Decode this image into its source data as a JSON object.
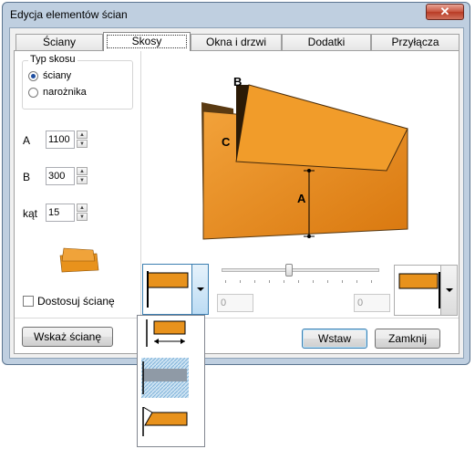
{
  "window": {
    "title": "Edycja elementów ścian",
    "close_glyph": "✕"
  },
  "tabs": [
    {
      "label": "Ściany",
      "active": false
    },
    {
      "label": "Skosy",
      "active": true
    },
    {
      "label": "Okna i drzwi",
      "active": false
    },
    {
      "label": "Dodatki",
      "active": false
    },
    {
      "label": "Przyłącza",
      "active": false
    }
  ],
  "slope_type": {
    "label": "Typ skosu",
    "options": [
      {
        "label": "ściany",
        "selected": true
      },
      {
        "label": "narożnika",
        "selected": false
      }
    ]
  },
  "fields": {
    "a": {
      "label": "A",
      "value": "1100"
    },
    "b": {
      "label": "B",
      "value": "300"
    },
    "angle": {
      "label": "kąt",
      "value": "15"
    }
  },
  "fit_wall": {
    "label": "Dostosuj ścianę",
    "checked": false
  },
  "preview": {
    "label_a": "A",
    "label_b": "B",
    "label_c": "C"
  },
  "offset_left": {
    "value": "0"
  },
  "offset_right": {
    "value": "0"
  },
  "slider": {
    "position_fraction": 0.43
  },
  "buttons": {
    "show_wall": "Wskaż ścianę",
    "insert": "Wstaw",
    "close": "Zamknij"
  },
  "colors": {
    "wall_orange": "#e8921c",
    "accent": "#3c7fb1"
  },
  "dropdown_icons": [
    "dimension-bar-icon",
    "hatched-bar-icon",
    "beveled-bar-icon"
  ]
}
